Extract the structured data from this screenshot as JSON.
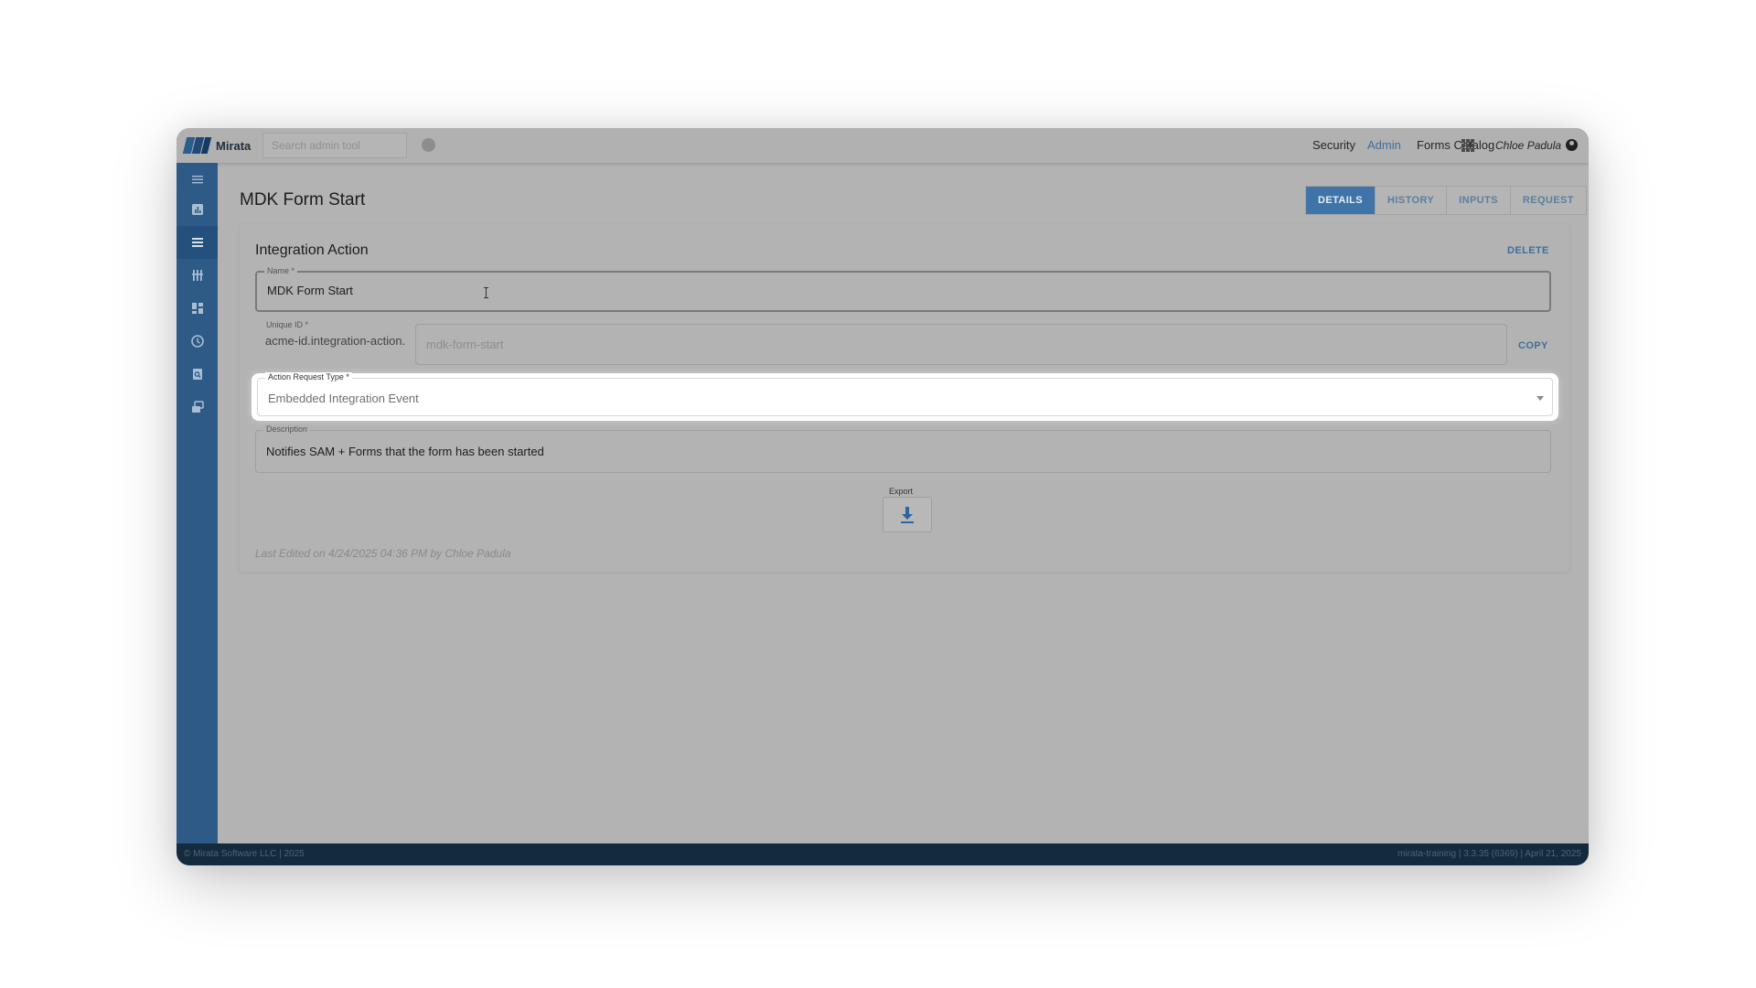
{
  "app": {
    "name": "Mirata"
  },
  "header": {
    "search_placeholder": "Search admin tool",
    "nav": [
      "Security",
      "Admin",
      "Forms Catalog"
    ],
    "user": "Chloe Padula"
  },
  "page": {
    "title": "MDK Form Start",
    "tabs": [
      "DETAILS",
      "HISTORY",
      "INPUTS",
      "REQUEST"
    ],
    "active_tab": "DETAILS"
  },
  "card": {
    "title": "Integration Action",
    "delete_label": "DELETE",
    "name": {
      "label": "Name *",
      "value": "MDK Form Start"
    },
    "unique_id": {
      "label": "Unique ID *",
      "prefix": "acme-id.integration-action.",
      "value": "mdk-form-start",
      "copy_label": "COPY"
    },
    "action_request_type": {
      "label": "Action Request Type *",
      "value": "Embedded Integration Event"
    },
    "description": {
      "label": "Description",
      "value": "Notifies SAM + Forms that the form has been started"
    },
    "export_label": "Export",
    "last_edited": "Last Edited on 4/24/2025 04:36 PM by Chloe Padula"
  },
  "footer": {
    "left": "© Mirata Software LLC | 2025",
    "right": "mirata-training | 3.3.35 (6369) | April 21, 2025"
  },
  "icons": {
    "sidebar": [
      "menu-icon",
      "chart-icon",
      "list-icon",
      "sliders-icon",
      "dashboard-icon",
      "clock-icon",
      "document-search-icon",
      "integration-icon"
    ],
    "export": "download-icon"
  },
  "colors": {
    "sidebar": "#2d5a87",
    "accent": "#3f74a8",
    "footer": "#142a3d"
  }
}
